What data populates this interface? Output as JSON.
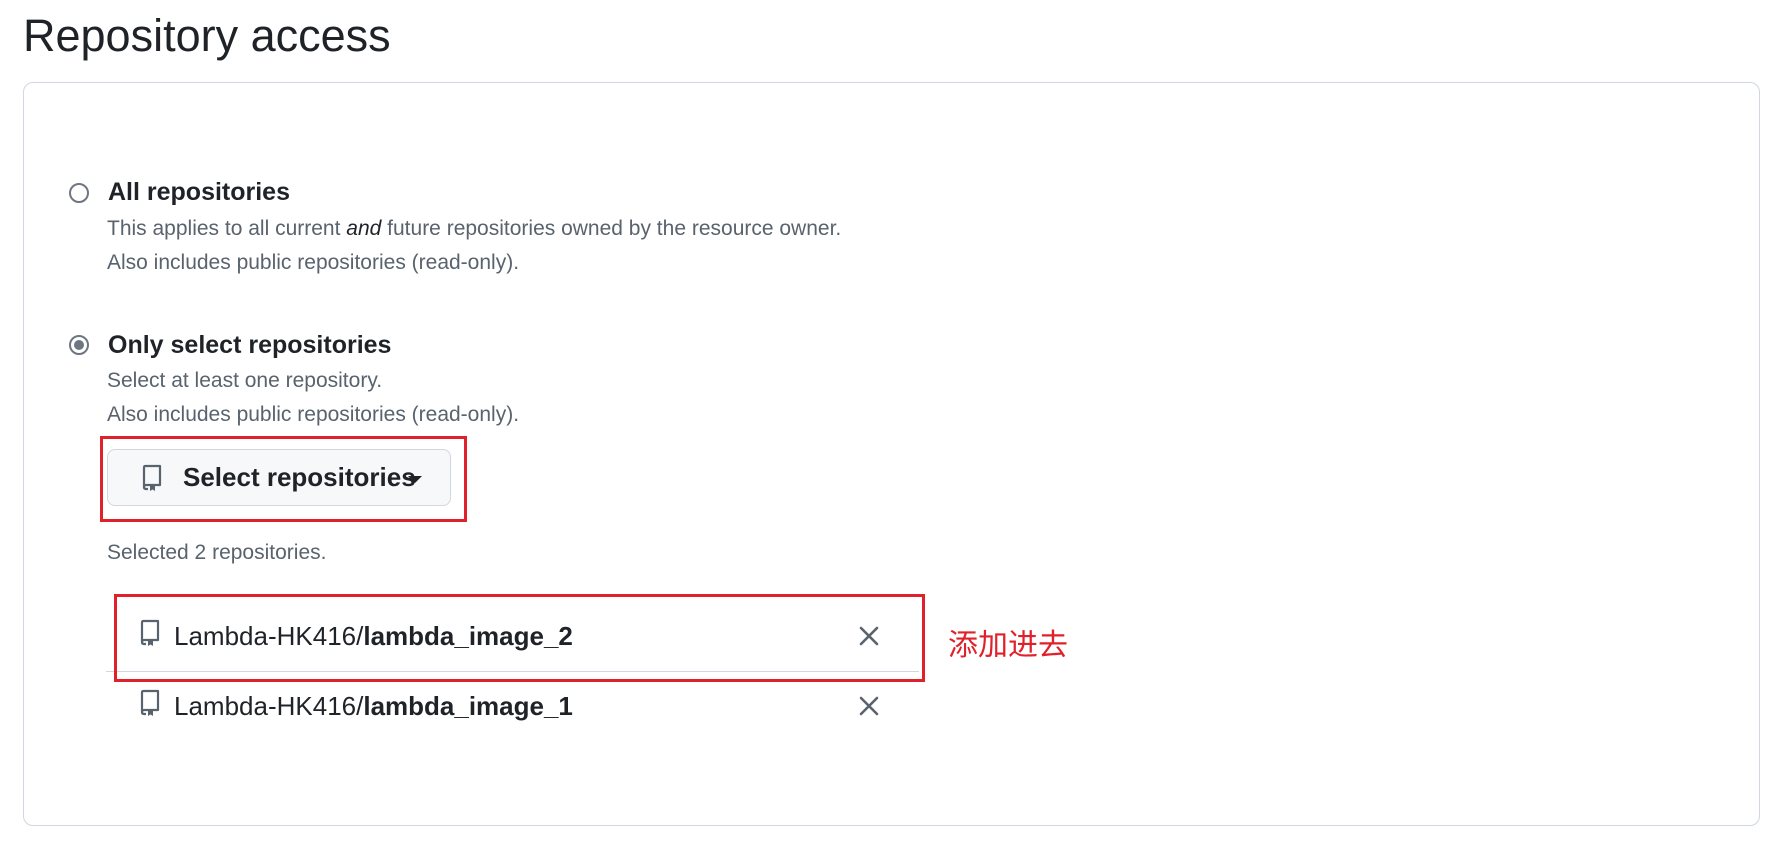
{
  "page": {
    "title": "Repository access"
  },
  "options": {
    "all": {
      "label": "All repositories",
      "desc_pre": "This applies to all current ",
      "desc_em": "and",
      "desc_post": " future repositories owned by the resource owner.",
      "desc2": "Also includes public repositories (read-only).",
      "checked": false
    },
    "select": {
      "label": "Only select repositories",
      "desc1": "Select at least one repository.",
      "desc2": "Also includes public repositories (read-only).",
      "checked": true
    }
  },
  "select_button": {
    "label": "Select repositories",
    "icon": "repo-icon",
    "caret_icon": "caret-down-icon"
  },
  "selected_count_text": "Selected 2 repositories.",
  "repos": [
    {
      "owner": "Lambda-HK416/",
      "name": "lambda_image_2",
      "icon": "repo-icon",
      "remove_icon": "close-icon"
    },
    {
      "owner": "Lambda-HK416/",
      "name": "lambda_image_1",
      "icon": "repo-icon",
      "remove_icon": "close-icon"
    }
  ],
  "annotation": {
    "text": "添加进去",
    "color": "#e0202a"
  },
  "colors": {
    "text": "#1f2328",
    "muted": "#59636e",
    "border": "#d0d7de",
    "highlight": "#e0202a"
  }
}
